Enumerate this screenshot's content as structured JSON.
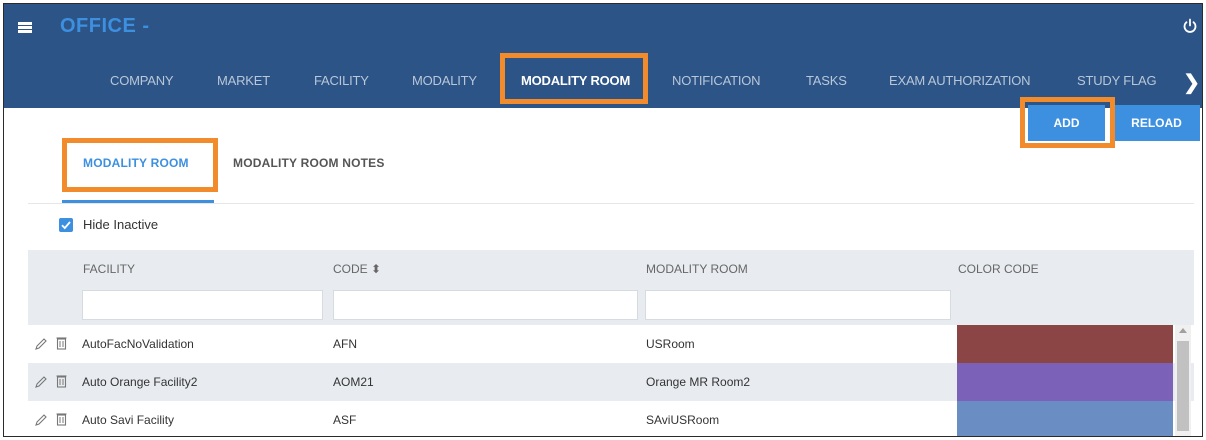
{
  "header": {
    "app_title": "OFFICE -",
    "icons": {
      "menu": "hamburger-menu-icon",
      "power": "power-icon",
      "next": "chevron-right-icon"
    }
  },
  "nav": {
    "items": [
      {
        "label": "COMPANY"
      },
      {
        "label": "MARKET"
      },
      {
        "label": "FACILITY"
      },
      {
        "label": "MODALITY"
      },
      {
        "label": "MODALITY ROOM",
        "active": true
      },
      {
        "label": "NOTIFICATION"
      },
      {
        "label": "TASKS"
      },
      {
        "label": "EXAM AUTHORIZATION"
      },
      {
        "label": "STUDY FLAG"
      }
    ],
    "next_arrow": "❯"
  },
  "actions": {
    "add_label": "ADD",
    "reload_label": "RELOAD"
  },
  "subtabs": [
    {
      "label": "MODALITY ROOM",
      "active": true
    },
    {
      "label": "MODALITY ROOM NOTES",
      "active": false
    }
  ],
  "filters": {
    "hide_inactive_label": "Hide Inactive",
    "hide_inactive_checked": true
  },
  "grid": {
    "columns": [
      {
        "label": "FACILITY"
      },
      {
        "label": "CODE ⬍"
      },
      {
        "label": "MODALITY ROOM"
      },
      {
        "label": "COLOR CODE"
      }
    ],
    "rows": [
      {
        "facility": "AutoFacNoValidation",
        "code": "AFN",
        "room": "USRoom",
        "color": "#8b4545"
      },
      {
        "facility": "Auto Orange Facility2",
        "code": "AOM21",
        "room": "Orange MR Room2",
        "color": "#7b62b8"
      },
      {
        "facility": "Auto Savi Facility",
        "code": "ASF",
        "room": "SAviUSRoom",
        "color": "#6a8ec4"
      }
    ]
  },
  "colors": {
    "topbar": "#2c5487",
    "accent": "#3d8fe0",
    "highlight": "#f28b2c"
  }
}
